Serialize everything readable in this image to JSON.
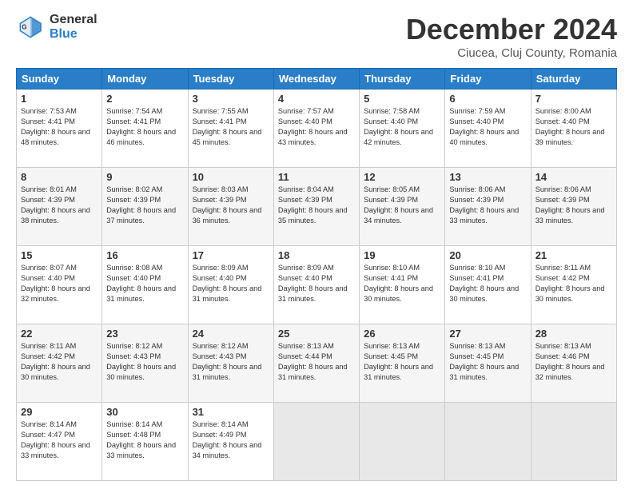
{
  "header": {
    "logo_general": "General",
    "logo_blue": "Blue",
    "month_title": "December 2024",
    "location": "Ciucea, Cluj County, Romania"
  },
  "weekdays": [
    "Sunday",
    "Monday",
    "Tuesday",
    "Wednesday",
    "Thursday",
    "Friday",
    "Saturday"
  ],
  "rows": [
    [
      {
        "day": "1",
        "sunrise": "7:53 AM",
        "sunset": "4:41 PM",
        "daylight": "8 hours and 48 minutes."
      },
      {
        "day": "2",
        "sunrise": "7:54 AM",
        "sunset": "4:41 PM",
        "daylight": "8 hours and 46 minutes."
      },
      {
        "day": "3",
        "sunrise": "7:55 AM",
        "sunset": "4:41 PM",
        "daylight": "8 hours and 45 minutes."
      },
      {
        "day": "4",
        "sunrise": "7:57 AM",
        "sunset": "4:40 PM",
        "daylight": "8 hours and 43 minutes."
      },
      {
        "day": "5",
        "sunrise": "7:58 AM",
        "sunset": "4:40 PM",
        "daylight": "8 hours and 42 minutes."
      },
      {
        "day": "6",
        "sunrise": "7:59 AM",
        "sunset": "4:40 PM",
        "daylight": "8 hours and 40 minutes."
      },
      {
        "day": "7",
        "sunrise": "8:00 AM",
        "sunset": "4:40 PM",
        "daylight": "8 hours and 39 minutes."
      }
    ],
    [
      {
        "day": "8",
        "sunrise": "8:01 AM",
        "sunset": "4:39 PM",
        "daylight": "8 hours and 38 minutes."
      },
      {
        "day": "9",
        "sunrise": "8:02 AM",
        "sunset": "4:39 PM",
        "daylight": "8 hours and 37 minutes."
      },
      {
        "day": "10",
        "sunrise": "8:03 AM",
        "sunset": "4:39 PM",
        "daylight": "8 hours and 36 minutes."
      },
      {
        "day": "11",
        "sunrise": "8:04 AM",
        "sunset": "4:39 PM",
        "daylight": "8 hours and 35 minutes."
      },
      {
        "day": "12",
        "sunrise": "8:05 AM",
        "sunset": "4:39 PM",
        "daylight": "8 hours and 34 minutes."
      },
      {
        "day": "13",
        "sunrise": "8:06 AM",
        "sunset": "4:39 PM",
        "daylight": "8 hours and 33 minutes."
      },
      {
        "day": "14",
        "sunrise": "8:06 AM",
        "sunset": "4:39 PM",
        "daylight": "8 hours and 33 minutes."
      }
    ],
    [
      {
        "day": "15",
        "sunrise": "8:07 AM",
        "sunset": "4:40 PM",
        "daylight": "8 hours and 32 minutes."
      },
      {
        "day": "16",
        "sunrise": "8:08 AM",
        "sunset": "4:40 PM",
        "daylight": "8 hours and 31 minutes."
      },
      {
        "day": "17",
        "sunrise": "8:09 AM",
        "sunset": "4:40 PM",
        "daylight": "8 hours and 31 minutes."
      },
      {
        "day": "18",
        "sunrise": "8:09 AM",
        "sunset": "4:40 PM",
        "daylight": "8 hours and 31 minutes."
      },
      {
        "day": "19",
        "sunrise": "8:10 AM",
        "sunset": "4:41 PM",
        "daylight": "8 hours and 30 minutes."
      },
      {
        "day": "20",
        "sunrise": "8:10 AM",
        "sunset": "4:41 PM",
        "daylight": "8 hours and 30 minutes."
      },
      {
        "day": "21",
        "sunrise": "8:11 AM",
        "sunset": "4:42 PM",
        "daylight": "8 hours and 30 minutes."
      }
    ],
    [
      {
        "day": "22",
        "sunrise": "8:11 AM",
        "sunset": "4:42 PM",
        "daylight": "8 hours and 30 minutes."
      },
      {
        "day": "23",
        "sunrise": "8:12 AM",
        "sunset": "4:43 PM",
        "daylight": "8 hours and 30 minutes."
      },
      {
        "day": "24",
        "sunrise": "8:12 AM",
        "sunset": "4:43 PM",
        "daylight": "8 hours and 31 minutes."
      },
      {
        "day": "25",
        "sunrise": "8:13 AM",
        "sunset": "4:44 PM",
        "daylight": "8 hours and 31 minutes."
      },
      {
        "day": "26",
        "sunrise": "8:13 AM",
        "sunset": "4:45 PM",
        "daylight": "8 hours and 31 minutes."
      },
      {
        "day": "27",
        "sunrise": "8:13 AM",
        "sunset": "4:45 PM",
        "daylight": "8 hours and 31 minutes."
      },
      {
        "day": "28",
        "sunrise": "8:13 AM",
        "sunset": "4:46 PM",
        "daylight": "8 hours and 32 minutes."
      }
    ],
    [
      {
        "day": "29",
        "sunrise": "8:14 AM",
        "sunset": "4:47 PM",
        "daylight": "8 hours and 33 minutes."
      },
      {
        "day": "30",
        "sunrise": "8:14 AM",
        "sunset": "4:48 PM",
        "daylight": "8 hours and 33 minutes."
      },
      {
        "day": "31",
        "sunrise": "8:14 AM",
        "sunset": "4:49 PM",
        "daylight": "8 hours and 34 minutes."
      },
      null,
      null,
      null,
      null
    ]
  ]
}
